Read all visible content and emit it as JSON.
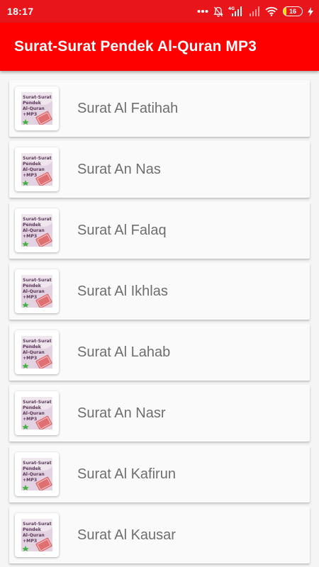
{
  "status_bar": {
    "time": "18:17",
    "network_label": "4G",
    "battery_level": "16",
    "bg_color": "#e8161b"
  },
  "app_bar": {
    "title": "Surat-Surat Pendek Al-Quran MP3",
    "bg_color": "#ff0000"
  },
  "list": {
    "items": [
      {
        "label": "Surat Al Fatihah",
        "icon": "quran-app-icon"
      },
      {
        "label": "Surat An Nas",
        "icon": "quran-app-icon"
      },
      {
        "label": "Surat Al Falaq",
        "icon": "quran-app-icon"
      },
      {
        "label": "Surat Al Ikhlas",
        "icon": "quran-app-icon"
      },
      {
        "label": "Surat Al Lahab",
        "icon": "quran-app-icon"
      },
      {
        "label": "Surat An Nasr",
        "icon": "quran-app-icon"
      },
      {
        "label": "Surat Al Kafirun",
        "icon": "quran-app-icon"
      },
      {
        "label": "Surat Al Kausar",
        "icon": "quran-app-icon"
      }
    ]
  }
}
